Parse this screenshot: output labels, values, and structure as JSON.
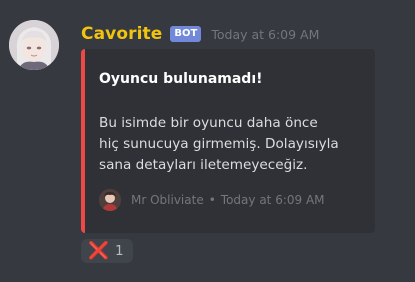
{
  "message": {
    "author": {
      "username": "Cavorite",
      "badge": "BOT",
      "avatar_icon": "anime-girl-avatar-icon",
      "username_color": "#f1c40f"
    },
    "timestamp": "Today at 6:09 AM",
    "embed": {
      "accent_color": "#f04747",
      "title": "Oyuncu bulunamadı!",
      "description_lines": [
        "Bu isimde bir oyuncu daha önce",
        "hiç sunucuya girmemiş. Dolayısıyla",
        "sana detayları iletemeyeceğiz."
      ],
      "footer": {
        "icon": "user-avatar-icon",
        "text": "Mr Obliviate",
        "separator": "•",
        "timestamp": "Today at 6:09 AM"
      }
    },
    "reaction": {
      "emoji": "❌",
      "emoji_icon": "cross-mark-icon",
      "count": "1"
    }
  },
  "colors": {
    "background": "#36393f",
    "embed_background": "#2f3136",
    "bot_badge": "#7289da",
    "muted_text": "#72767d"
  }
}
